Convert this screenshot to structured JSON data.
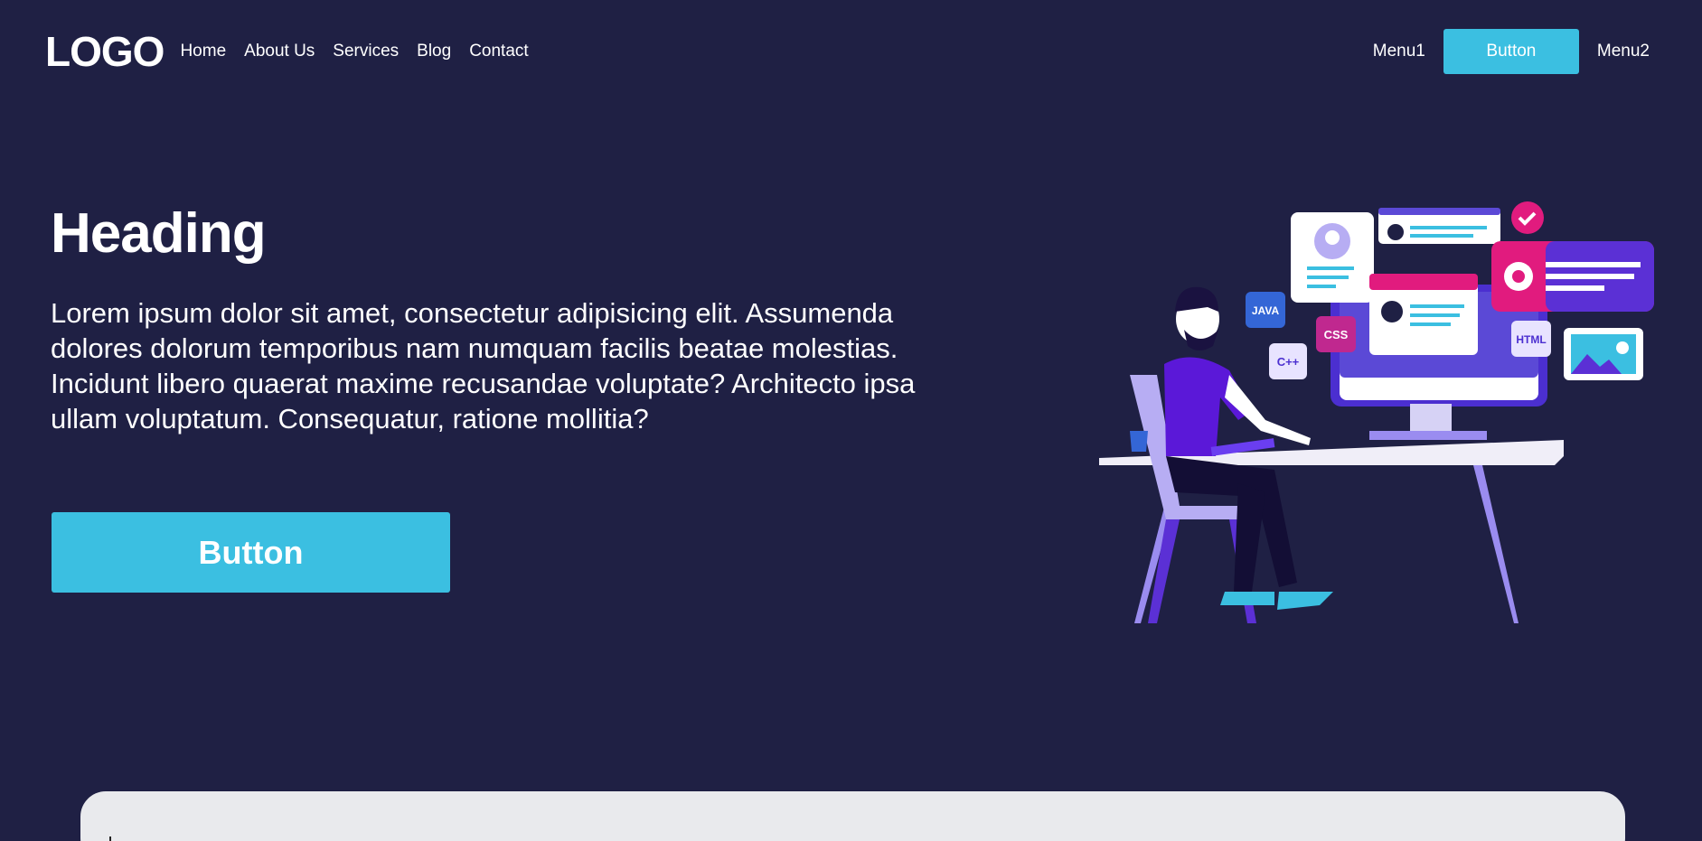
{
  "nav": {
    "logo": "LOGO",
    "links": [
      "Home",
      "About Us",
      "Services",
      "Blog",
      "Contact"
    ],
    "menu1": "Menu1",
    "button": "Button",
    "menu2": "Menu2"
  },
  "hero": {
    "heading": "Heading",
    "lead": "Lorem ipsum dolor sit amet, consectetur adipisicing elit. Assumenda dolores dolorum temporibus nam numquam facilis beatae molestias. Incidunt libero quaerat maxime recusandae voluptate? Architecto ipsa ullam voluptatum. Consequatur, ratione mollitia?",
    "button": "Button"
  },
  "illustration": {
    "tags": [
      "JAVA",
      "CSS",
      "C++",
      "HTML"
    ]
  },
  "colors": {
    "background": "#1f2044",
    "accent": "#3bbfe1",
    "card": "#e9eaed"
  }
}
